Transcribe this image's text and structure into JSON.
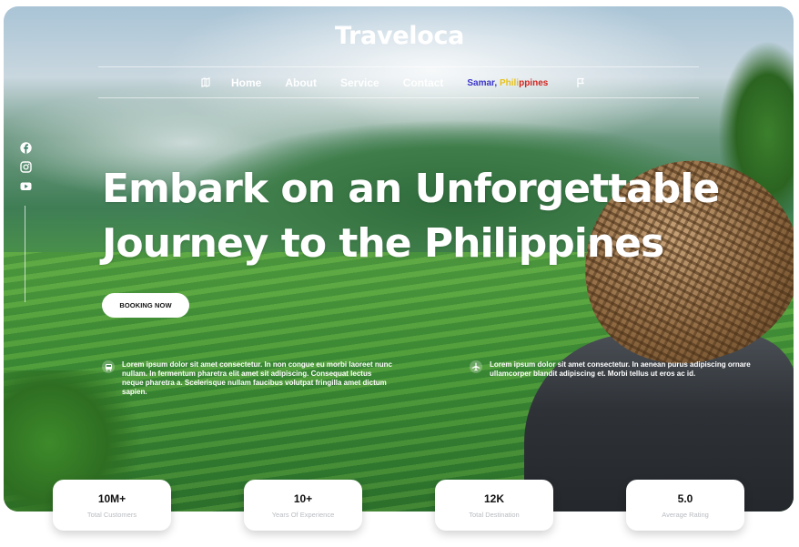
{
  "brand": {
    "logo": "Traveloca"
  },
  "nav": {
    "items": [
      "Home",
      "About",
      "Service",
      "Contact"
    ],
    "location": {
      "part1": "Samar, ",
      "part2": "Phili",
      "part3": "ppines"
    },
    "icons": [
      "map-pin-icon",
      "flag-icon"
    ]
  },
  "social": {
    "icons": [
      "facebook-icon",
      "instagram-icon",
      "youtube-icon"
    ]
  },
  "hero": {
    "headline_line1": "Embark on an Unforgettable",
    "headline_line2": "Journey to the Philippines",
    "cta": "BOOKING NOW"
  },
  "features": [
    {
      "icon": "bus-icon",
      "text": "Lorem ipsum dolor sit amet consectetur. In non congue eu morbi laoreet nunc nullam. In fermentum pharetra elit amet sit adipiscing. Consequat lectus neque pharetra a. Scelerisque nullam faucibus volutpat fringilla amet dictum sapien."
    },
    {
      "icon": "airplane-icon",
      "text": "Lorem ipsum dolor sit amet consectetur. In aenean purus adipiscing ornare ullamcorper blandit adipiscing et. Morbi tellus ut eros ac id."
    }
  ],
  "stats": [
    {
      "value": "10M+",
      "label": "Total Customers"
    },
    {
      "value": "10+",
      "label": "Years Of Experience"
    },
    {
      "value": "12K",
      "label": "Total Destination"
    },
    {
      "value": "5.0",
      "label": "Average Rating"
    }
  ],
  "colors": {
    "location_blue": "#3a35c8",
    "location_yellow": "#e8c21a",
    "location_red": "#d3241d"
  }
}
